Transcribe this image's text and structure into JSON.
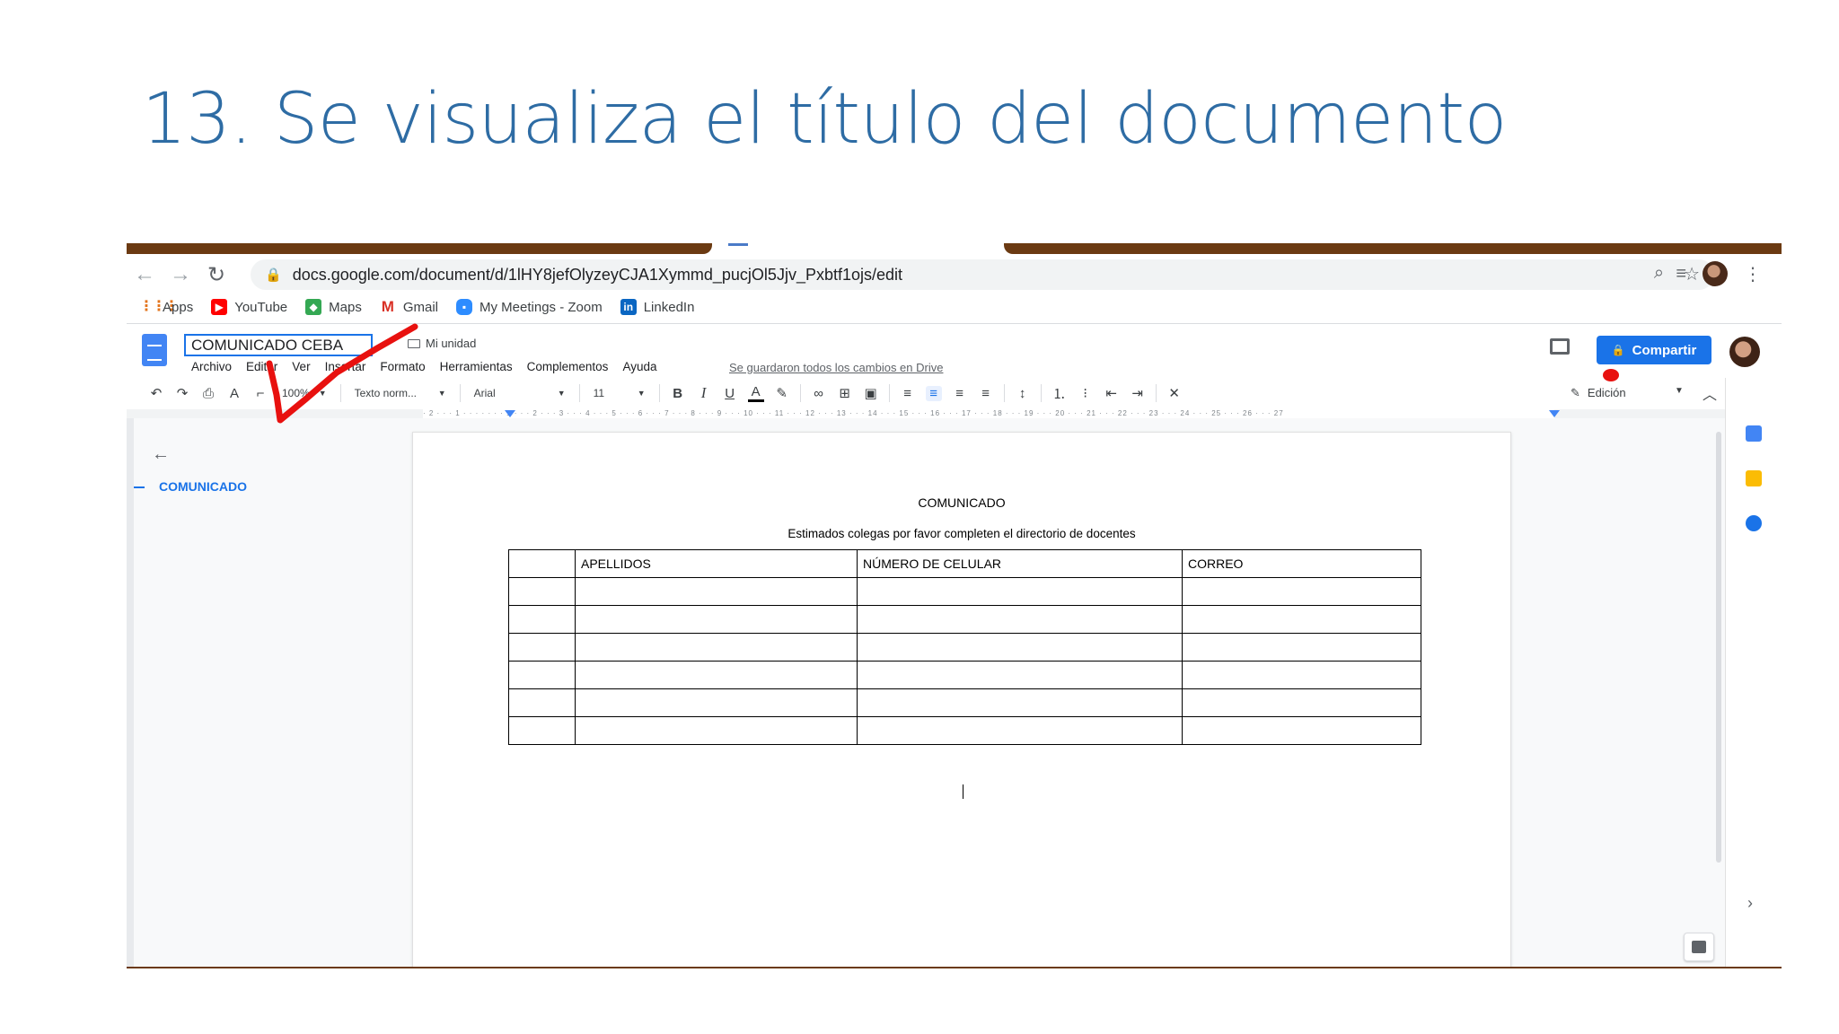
{
  "slide": {
    "title": "13. Se visualiza el título del documento"
  },
  "browser": {
    "url": "docs.google.com/document/d/1lHY8jefOlyzeyCJA1Xymmd_pucjOl5Jjv_Pxbtf1ojs/edit",
    "bookmarks": [
      "Apps",
      "YouTube",
      "Maps",
      "Gmail",
      "My Meetings - Zoom",
      "LinkedIn"
    ]
  },
  "docs": {
    "title": "COMUNICADO CEBA",
    "folder": "Mi unidad",
    "menu": [
      "Archivo",
      "Editar",
      "Ver",
      "Insertar",
      "Formato",
      "Herramientas",
      "Complementos",
      "Ayuda"
    ],
    "saved_status": "Se guardaron todos los cambios en Drive",
    "share_label": "Compartir",
    "toolbar": {
      "zoom": "100%",
      "style": "Texto norm...",
      "font": "Arial",
      "size": "11",
      "mode": "Edición"
    },
    "ruler_text": "· 2 · · · 1 · · · · · · · 1 · · · 2 · · · 3 · · · 4 · · · 5 · · · 6 · · · 7 · · · 8 · · · 9 · · · 10 · · · 11 · · · 12 · · · 13 · · · 14 · · · 15 · · · 16 · · · 17 · · · 18 · · · 19 · · · 20 · · · 21 · · · 22 · · · 23 · · · 24 · · · 25 · · · 26 · · · 27",
    "outline": {
      "item": "COMUNICADO"
    }
  },
  "document": {
    "heading": "COMUNICADO",
    "subtitle": "Estimados colegas por favor completen el directorio de docentes",
    "table": {
      "headers": [
        "",
        "APELLIDOS",
        "NÚMERO DE CELULAR",
        "CORREO"
      ],
      "empty_rows": 6
    }
  },
  "colors": {
    "title_blue": "#2e6ca4",
    "docs_blue": "#1a73e8",
    "annotation_red": "#e8110f",
    "tab_brown": "#6b3a12"
  }
}
